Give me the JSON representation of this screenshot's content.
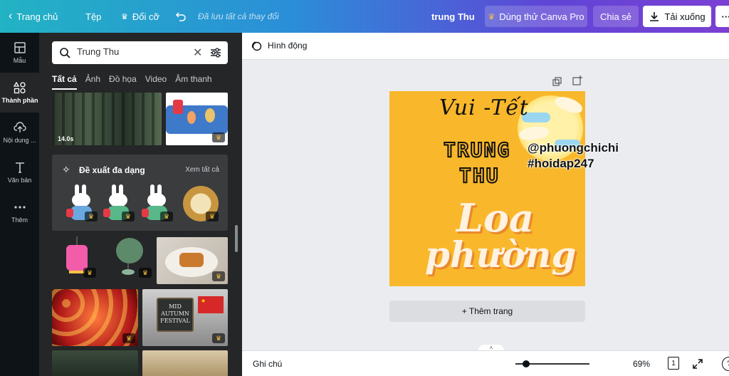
{
  "topbar": {
    "home_label": "Trang chủ",
    "file_label": "Tệp",
    "resize_label": "Đổi cỡ",
    "saved_status": "Đã lưu tất cả thay đổi",
    "doc_title": "trung Thu",
    "try_pro_label": "Dùng thử Canva Pro",
    "share_label": "Chia sẻ",
    "download_label": "Tải xuống",
    "more_label": "···"
  },
  "leftnav": {
    "items": [
      {
        "label": "Mẫu",
        "icon": "template-icon"
      },
      {
        "label": "Thành phần",
        "icon": "elements-icon"
      },
      {
        "label": "Nội dung ...",
        "icon": "upload-icon"
      },
      {
        "label": "Văn bản",
        "icon": "text-icon"
      },
      {
        "label": "Thêm",
        "icon": "more-icon"
      }
    ]
  },
  "panel": {
    "search_value": "Trung Thu",
    "tabs": [
      "Tất cả",
      "Ảnh",
      "Đồ họa",
      "Video",
      "Âm thanh"
    ],
    "video_duration": "14.0s",
    "suggest_title": "Đề xuất đa dạng",
    "see_all": "Xem tất cả",
    "autumn_sign": "MID AUTUMN FESTIVAL"
  },
  "workspace": {
    "animate_label": "Hình động",
    "add_page_label": "+ Thêm trang",
    "notes_label": "Ghi chú",
    "zoom_level": "69%",
    "page_count": "1"
  },
  "design": {
    "line1": "Vui -Tết",
    "line2": "TRUNG",
    "line3": "THU",
    "line4": "Loa",
    "line5": "phường"
  },
  "overlay": {
    "handle": "@phuongchichi",
    "hashtag": "#hoidap247"
  },
  "colors": {
    "canvas_bg": "#f9b82b",
    "panel_bg": "#252627",
    "nav_bg": "#0e1318"
  }
}
